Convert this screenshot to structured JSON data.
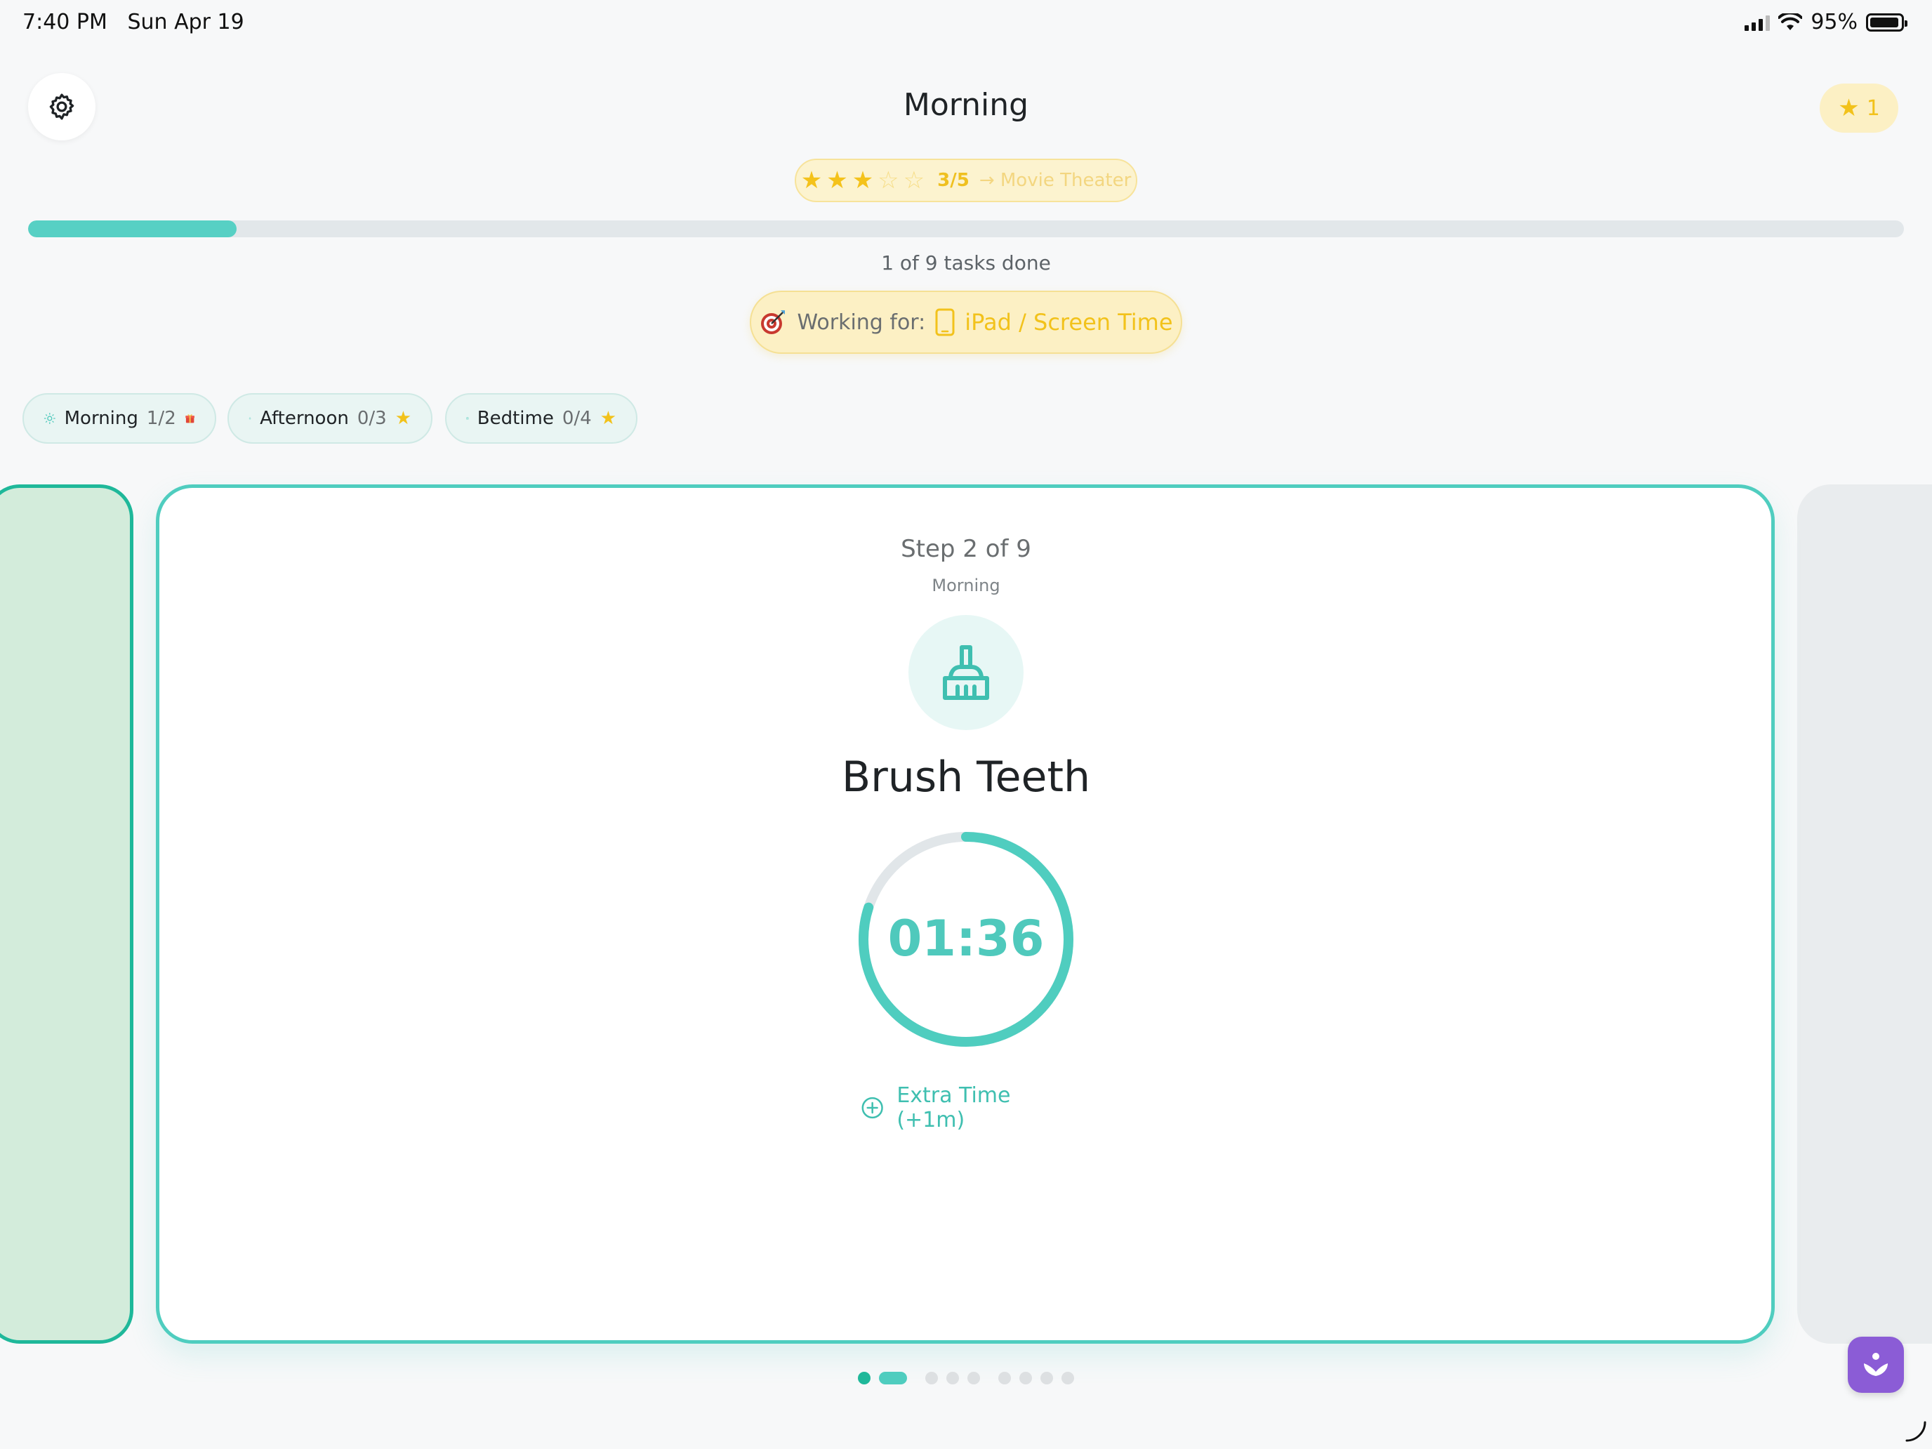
{
  "status_bar": {
    "time": "7:40 PM",
    "date": "Sun Apr 19",
    "battery": "95%",
    "battery_level": 0.95
  },
  "header": {
    "title": "Morning",
    "star_count": "1",
    "settings_icon": "gear-icon"
  },
  "reward": {
    "stars_filled": 3,
    "stars_total": 5,
    "count": "3/5",
    "target": "→ Movie Theater"
  },
  "progress": {
    "fraction": 0.111,
    "text": "1 of 9 tasks done"
  },
  "working_for": {
    "label": "Working for:",
    "value": "iPad / Screen Time",
    "icon": "dart-target-icon",
    "value_icon": "tablet-icon"
  },
  "routine_tabs": [
    {
      "name": "Morning",
      "count": "1/2",
      "icon": "sun-icon",
      "badge": "gift-icon"
    },
    {
      "name": "Afternoon",
      "count": "0/3",
      "icon": "tree-icon",
      "badge": "star-icon"
    },
    {
      "name": "Bedtime",
      "count": "0/4",
      "icon": "calendar-icon",
      "badge": "star-icon"
    }
  ],
  "card": {
    "step": "Step 2 of 9",
    "routine": "Morning",
    "task": "Brush Teeth",
    "task_icon": "brush-icon",
    "timer": "01:36",
    "timer_remaining_fraction": 0.8,
    "extra_time": "Extra Time (+1m)"
  },
  "pager": {
    "total": 9,
    "current_index": 1
  },
  "colors": {
    "accent": "#4fcdbf",
    "accent_dark": "#1fb89a",
    "gold": "#f2c21b",
    "fab": "#8b5cd6"
  }
}
